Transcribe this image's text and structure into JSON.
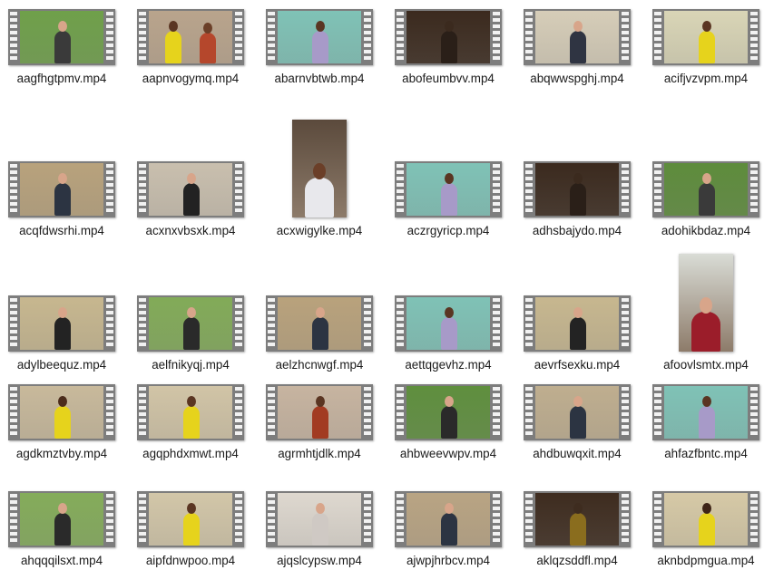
{
  "files": [
    {
      "name": "aagfhgtpmv.mp4",
      "kind": "video",
      "icon": "video-thumbnail-icon",
      "colors": {
        "wall": "#6fa04a",
        "body": "#3a3a3a",
        "head": "#d8a58a"
      }
    },
    {
      "name": "aapnvogymq.mp4",
      "kind": "video",
      "icon": "video-thumbnail-icon",
      "colors": {
        "wall": "#b9a48c",
        "body": "#e6d31c",
        "head": "#5a3522",
        "body2": "#b5472c"
      }
    },
    {
      "name": "abarnvbtwb.mp4",
      "kind": "video",
      "icon": "video-thumbnail-icon",
      "colors": {
        "wall": "#7fc2b6",
        "body": "#a79ac8",
        "head": "#5a3522"
      }
    },
    {
      "name": "abofeumbvv.mp4",
      "kind": "video",
      "icon": "video-thumbnail-icon",
      "colors": {
        "wall": "#3b2a1e",
        "body": "#2a1f18",
        "head": "#3b2a1e"
      }
    },
    {
      "name": "abqwwspghj.mp4",
      "kind": "video",
      "icon": "video-thumbnail-icon",
      "colors": {
        "wall": "#d6cdb8",
        "body": "#2f3442",
        "head": "#d8a58a"
      }
    },
    {
      "name": "acifjvzvpm.mp4",
      "kind": "video",
      "icon": "video-thumbnail-icon",
      "colors": {
        "wall": "#d9d5b6",
        "body": "#e6d31c",
        "head": "#5a3522"
      }
    },
    {
      "name": "acqfdwsrhi.mp4",
      "kind": "video",
      "icon": "video-thumbnail-icon",
      "colors": {
        "wall": "#b8a27c",
        "body": "#2c3442",
        "head": "#d8a58a"
      }
    },
    {
      "name": "acxnxvbsxk.mp4",
      "kind": "video",
      "icon": "video-thumbnail-icon",
      "colors": {
        "wall": "#c9bfae",
        "body": "#222222",
        "head": "#d8a58a"
      }
    },
    {
      "name": "acxwigylke.mp4",
      "kind": "portrait",
      "icon": "video-thumbnail-icon",
      "colors": {
        "wall": "#5b4a3c",
        "body": "#e8e8ec",
        "head": "#6b3f28"
      }
    },
    {
      "name": "aczrgyricp.mp4",
      "kind": "video",
      "icon": "video-thumbnail-icon",
      "colors": {
        "wall": "#7fc2b6",
        "body": "#a79ac8",
        "head": "#5a3522"
      }
    },
    {
      "name": "adhsbajydo.mp4",
      "kind": "video",
      "icon": "video-thumbnail-icon",
      "colors": {
        "wall": "#3b2a1e",
        "body": "#2a1f18",
        "head": "#3b2a1e"
      }
    },
    {
      "name": "adohikbdaz.mp4",
      "kind": "video",
      "icon": "video-thumbnail-icon",
      "colors": {
        "wall": "#5e8c3c",
        "body": "#3a3a3a",
        "head": "#d8a58a"
      }
    },
    {
      "name": "adylbeequz.mp4",
      "kind": "video",
      "icon": "video-thumbnail-icon",
      "colors": {
        "wall": "#c7b78f",
        "body": "#232323",
        "head": "#d8a58a"
      }
    },
    {
      "name": "aelfnikyqj.mp4",
      "kind": "video",
      "icon": "video-thumbnail-icon",
      "colors": {
        "wall": "#82ab58",
        "body": "#2a2a2a",
        "head": "#d8a58a"
      }
    },
    {
      "name": "aelzhcnwgf.mp4",
      "kind": "video",
      "icon": "video-thumbnail-icon",
      "colors": {
        "wall": "#b9a27c",
        "body": "#2c3442",
        "head": "#d8a58a"
      }
    },
    {
      "name": "aettqgevhz.mp4",
      "kind": "video",
      "icon": "video-thumbnail-icon",
      "colors": {
        "wall": "#7fc2b6",
        "body": "#a79ac8",
        "head": "#5a3522"
      }
    },
    {
      "name": "aevrfsexku.mp4",
      "kind": "video",
      "icon": "video-thumbnail-icon",
      "colors": {
        "wall": "#c7b78f",
        "body": "#232323",
        "head": "#d8a58a"
      }
    },
    {
      "name": "afoovlsmtx.mp4",
      "kind": "portrait",
      "icon": "video-thumbnail-icon",
      "colors": {
        "wall": "#d9dcd6",
        "body": "#9b1d2a",
        "head": "#d8a58a"
      }
    },
    {
      "name": "agdkmztvby.mp4",
      "kind": "video",
      "icon": "video-thumbnail-icon",
      "colors": {
        "wall": "#c8b99b",
        "body": "#e6d31c",
        "head": "#4b2c1c"
      }
    },
    {
      "name": "agqphdxmwt.mp4",
      "kind": "video",
      "icon": "video-thumbnail-icon",
      "colors": {
        "wall": "#d1c4a6",
        "body": "#e6d31c",
        "head": "#5a3522"
      }
    },
    {
      "name": "agrmhtjdlk.mp4",
      "kind": "video",
      "icon": "video-thumbnail-icon",
      "colors": {
        "wall": "#c7b4a0",
        "body": "#a23b22",
        "head": "#5a3522"
      }
    },
    {
      "name": "ahbweevwpv.mp4",
      "kind": "video",
      "icon": "video-thumbnail-icon",
      "colors": {
        "wall": "#5f8f3e",
        "body": "#2a2a2a",
        "head": "#d8a58a"
      }
    },
    {
      "name": "ahdbuwqxit.mp4",
      "kind": "video",
      "icon": "video-thumbnail-icon",
      "colors": {
        "wall": "#bfae8f",
        "body": "#2c3442",
        "head": "#d8a58a"
      }
    },
    {
      "name": "ahfazfbntc.mp4",
      "kind": "video",
      "icon": "video-thumbnail-icon",
      "colors": {
        "wall": "#7fc2b6",
        "body": "#a79ac8",
        "head": "#5a3522"
      }
    },
    {
      "name": "ahqqqilsxt.mp4",
      "kind": "video",
      "icon": "video-thumbnail-icon",
      "colors": {
        "wall": "#84ac5a",
        "body": "#2a2a2a",
        "head": "#d8a58a"
      }
    },
    {
      "name": "aipfdnwpoo.mp4",
      "kind": "video",
      "icon": "video-thumbnail-icon",
      "colors": {
        "wall": "#d2c6a8",
        "body": "#e6d31c",
        "head": "#5a3522"
      }
    },
    {
      "name": "ajqslcypsw.mp4",
      "kind": "video",
      "icon": "video-thumbnail-icon",
      "colors": {
        "wall": "#ded8cf",
        "body": "#cfc9c4",
        "head": "#d8a58a"
      }
    },
    {
      "name": "ajwpjhrbcv.mp4",
      "kind": "video",
      "icon": "video-thumbnail-icon",
      "colors": {
        "wall": "#b9a483",
        "body": "#2c3442",
        "head": "#d8a58a"
      }
    },
    {
      "name": "aklqzsddfl.mp4",
      "kind": "video",
      "icon": "video-thumbnail-icon",
      "colors": {
        "wall": "#3e2c1f",
        "body": "#8a6d1e",
        "head": "#3e2c1f"
      }
    },
    {
      "name": "aknbdpmgua.mp4",
      "kind": "video",
      "icon": "video-thumbnail-icon",
      "colors": {
        "wall": "#d6c9a6",
        "body": "#e6d31c",
        "head": "#3e2417"
      }
    }
  ]
}
